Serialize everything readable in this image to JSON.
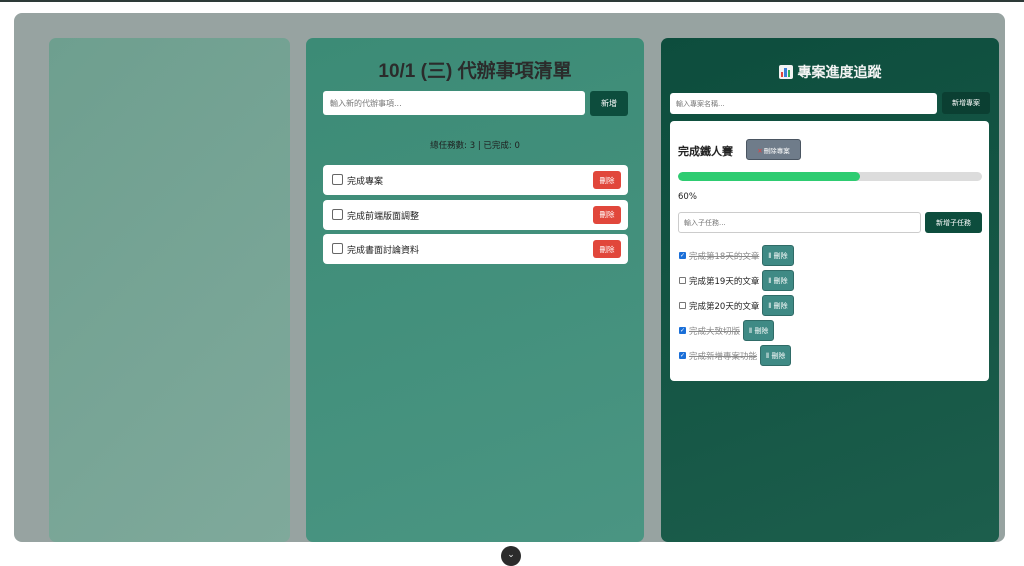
{
  "todo": {
    "title": "10/1 (三) 代辦事項清單",
    "input_placeholder": "輸入新的代辦事項...",
    "add_label": "新增",
    "stats": "總任務數: 3 | 已完成: 0",
    "items": [
      {
        "text": "完成專案",
        "delete_label": "刪除"
      },
      {
        "text": "完成前端版面調整",
        "delete_label": "刪除"
      },
      {
        "text": "完成書面討論資料",
        "delete_label": "刪除"
      }
    ]
  },
  "projects": {
    "title": "專案進度追蹤",
    "title_icon": "bar-chart-icon",
    "input_placeholder": "輸入專案名稱...",
    "add_label": "新增專案",
    "project": {
      "name": "完成鐵人賽",
      "delete_label": "刪除專案",
      "delete_icon": "cross-mark-icon",
      "progress": 0.6,
      "progress_label": "60%",
      "subtask_placeholder": "輸入子任務...",
      "subtask_add_label": "新增子任務",
      "subtasks": [
        {
          "text": "完成第18天的文章",
          "done": true,
          "delete_label": "刪除"
        },
        {
          "text": "完成第19天的文章",
          "done": false,
          "delete_label": "刪除"
        },
        {
          "text": "完成第20天的文章",
          "done": false,
          "delete_label": "刪除"
        },
        {
          "text": "完成大致切版",
          "done": true,
          "delete_label": "刪除"
        },
        {
          "text": "完成新增專案功能",
          "done": true,
          "delete_label": "刪除"
        }
      ]
    }
  },
  "colors": {
    "progress_fill": "#2ecc71",
    "delete_red": "#e1473b",
    "primary_dark": "#0d4d3d"
  },
  "footer": {
    "expand_icon": "chevron-down-icon"
  }
}
